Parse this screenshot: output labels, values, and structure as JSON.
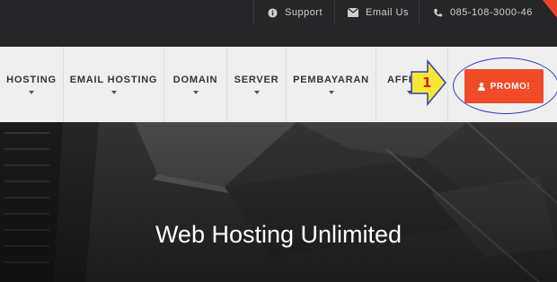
{
  "topbar": {
    "support_label": "Support",
    "email_label": "Email Us",
    "phone_label": "085-108-3000-46",
    "support_icon": "info-circle-icon",
    "email_icon": "envelope-icon",
    "phone_icon": "phone-icon",
    "accent_color": "#e8442a"
  },
  "nav": {
    "items": [
      {
        "label": "HOSTING"
      },
      {
        "label": "EMAIL HOSTING"
      },
      {
        "label": "DOMAIN"
      },
      {
        "label": "SERVER"
      },
      {
        "label": "PEMBAYARAN"
      },
      {
        "label": "AFFI"
      }
    ]
  },
  "promo": {
    "label": "PROMO!",
    "icon": "user-icon",
    "color": "#f04a28"
  },
  "annotation": {
    "step_number": "1",
    "arrow_color": "#f6e832",
    "oval_color": "#2f3cc0"
  },
  "hero": {
    "title": "Web Hosting Unlimited"
  }
}
